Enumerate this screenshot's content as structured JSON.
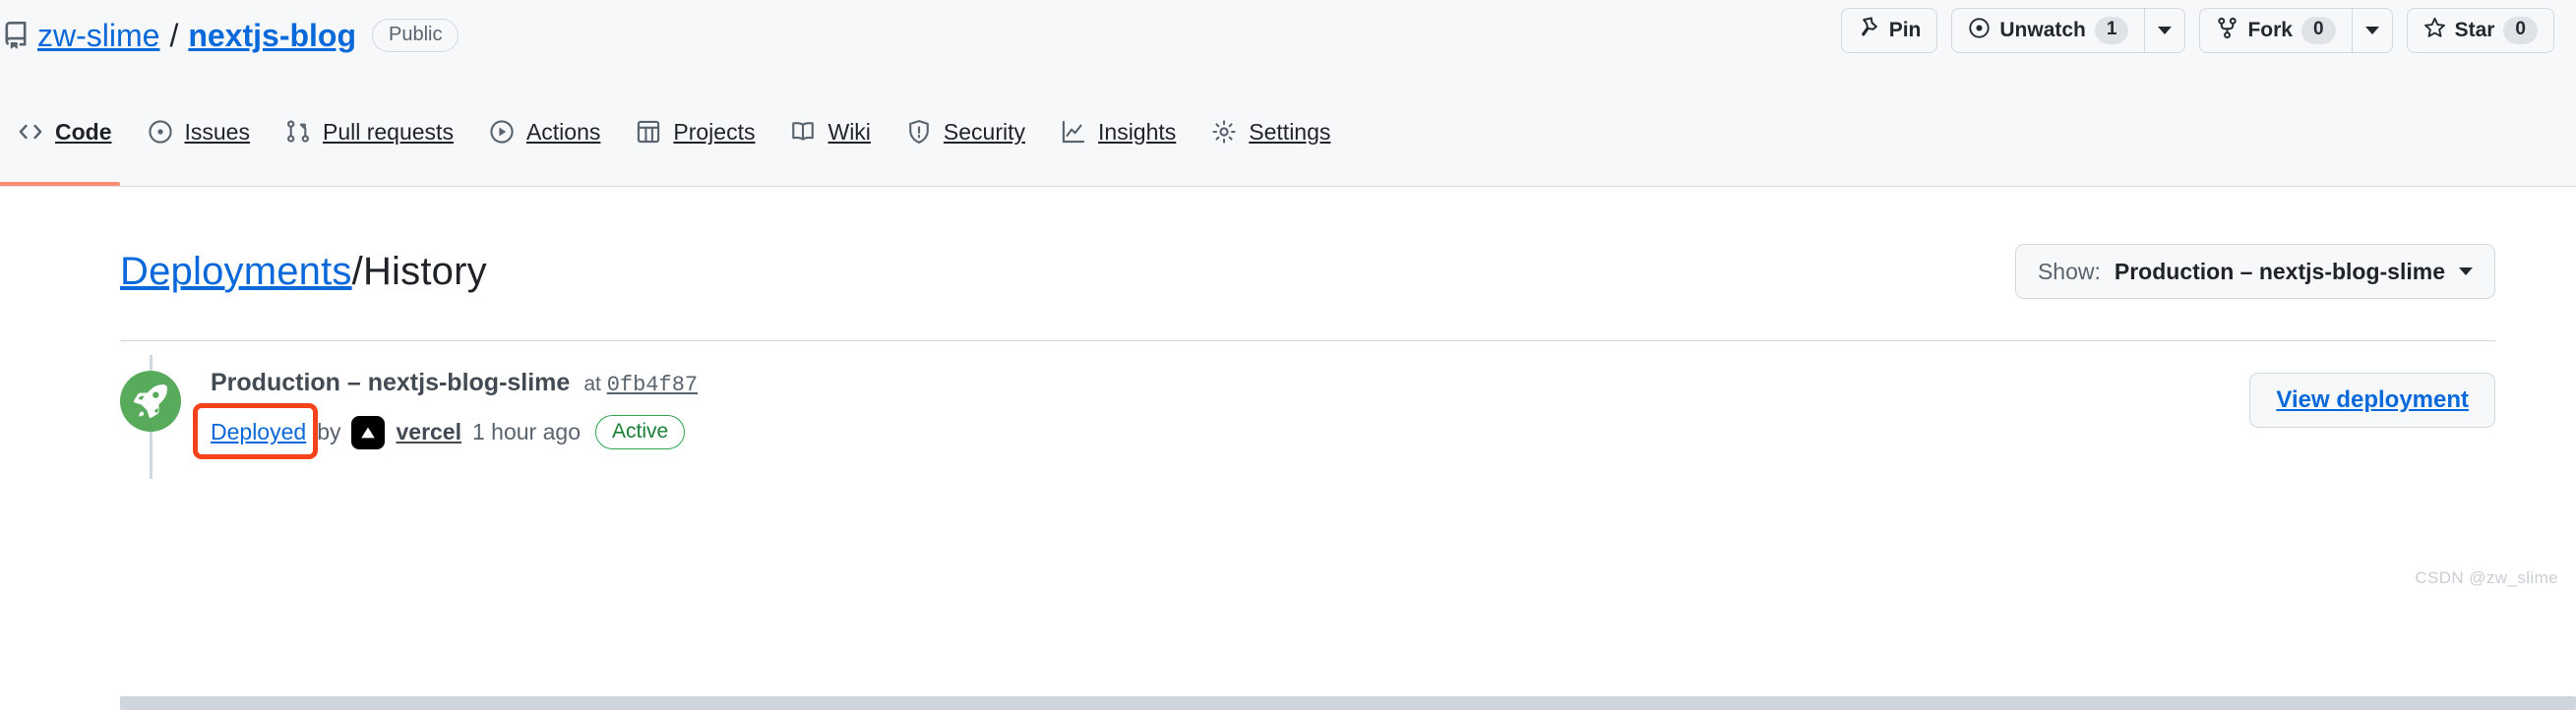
{
  "repo": {
    "icon": "repo-icon",
    "owner": "zw-slime",
    "separator": "/",
    "name": "nextjs-blog",
    "visibility": "Public"
  },
  "header_actions": {
    "pin": {
      "label": "Pin",
      "icon": "pin-icon"
    },
    "watch": {
      "label": "Unwatch",
      "count": "1",
      "icon": "eye-icon"
    },
    "fork": {
      "label": "Fork",
      "count": "0",
      "icon": "fork-icon"
    },
    "star": {
      "label": "Star",
      "count": "0",
      "icon": "star-icon"
    }
  },
  "nav_tabs": [
    {
      "label": "Code",
      "icon": "code-icon",
      "active": true
    },
    {
      "label": "Issues",
      "icon": "issue-opened-icon",
      "active": false
    },
    {
      "label": "Pull requests",
      "icon": "git-pull-request-icon",
      "active": false
    },
    {
      "label": "Actions",
      "icon": "play-icon",
      "active": false
    },
    {
      "label": "Projects",
      "icon": "table-icon",
      "active": false
    },
    {
      "label": "Wiki",
      "icon": "book-icon",
      "active": false
    },
    {
      "label": "Security",
      "icon": "shield-icon",
      "active": false
    },
    {
      "label": "Insights",
      "icon": "graph-icon",
      "active": false
    },
    {
      "label": "Settings",
      "icon": "gear-icon",
      "active": false
    }
  ],
  "page": {
    "breadcrumb_link": "Deployments",
    "breadcrumb_separator": "/",
    "breadcrumb_current": "History",
    "show_filter": {
      "prefix": "Show:",
      "value": "Production – nextjs-blog-slime",
      "caret_icon": "chevron-down-icon"
    }
  },
  "deployments": [
    {
      "avatar_icon": "rocket-icon",
      "environment": "Production – nextjs-blog-slime",
      "at_label": "at",
      "commit_sha": "0fb4f87",
      "deployed_link": "Deployed",
      "by_label": "by",
      "actor_icon": "vercel-logo-icon",
      "actor": "vercel",
      "relative_time": "1 hour ago",
      "status": "Active",
      "view_button": "View deployment"
    }
  ],
  "annotation": {
    "target": "Deployed",
    "color": "#f4421a"
  },
  "watermark": "CSDN @zw_slime",
  "colors": {
    "link": "#0969da",
    "header_bg": "#f6f8fa",
    "border": "#d1d9e0",
    "active_tab_underline": "#fd8c73",
    "rocket_bg": "#57ab5a",
    "status_green": "#1a7f37",
    "annotation_red": "#f4421a"
  }
}
